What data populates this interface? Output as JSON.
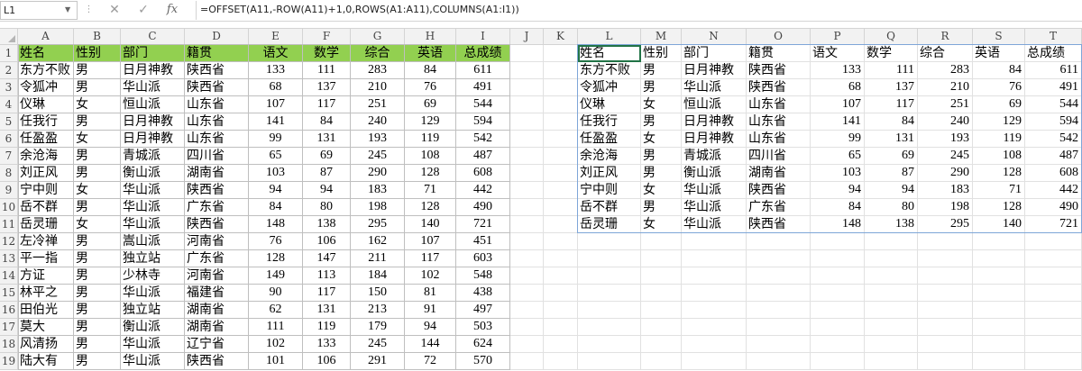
{
  "formula_bar": {
    "name_box": "L1",
    "dots": "⋮",
    "cancel_icon": "✕",
    "enter_icon": "✓",
    "fx_icon": "fx",
    "formula": "=OFFSET(A11,-ROW(A11)+1,0,ROWS(A1:A11),COLUMNS(A1:I1))"
  },
  "columns": [
    "A",
    "B",
    "C",
    "D",
    "E",
    "F",
    "G",
    "H",
    "I",
    "J",
    "K",
    "L",
    "M",
    "N",
    "O",
    "P",
    "Q",
    "R",
    "S",
    "T"
  ],
  "rows": [
    "1",
    "2",
    "3",
    "4",
    "5",
    "6",
    "7",
    "8",
    "9",
    "10",
    "11",
    "12",
    "13",
    "14",
    "15",
    "16",
    "17",
    "18",
    "19"
  ],
  "headers": [
    "姓名",
    "性别",
    "部门",
    "籍贯",
    "语文",
    "数学",
    "综合",
    "英语",
    "总成绩"
  ],
  "records": [
    [
      "东方不败",
      "男",
      "日月神教",
      "陕西省",
      "133",
      "111",
      "283",
      "84",
      "611"
    ],
    [
      "令狐冲",
      "男",
      "华山派",
      "陕西省",
      "68",
      "137",
      "210",
      "76",
      "491"
    ],
    [
      "仪琳",
      "女",
      "恒山派",
      "山东省",
      "107",
      "117",
      "251",
      "69",
      "544"
    ],
    [
      "任我行",
      "男",
      "日月神教",
      "山东省",
      "141",
      "84",
      "240",
      "129",
      "594"
    ],
    [
      "任盈盈",
      "女",
      "日月神教",
      "山东省",
      "99",
      "131",
      "193",
      "119",
      "542"
    ],
    [
      "余沧海",
      "男",
      "青城派",
      "四川省",
      "65",
      "69",
      "245",
      "108",
      "487"
    ],
    [
      "刘正风",
      "男",
      "衡山派",
      "湖南省",
      "103",
      "87",
      "290",
      "128",
      "608"
    ],
    [
      "宁中则",
      "女",
      "华山派",
      "陕西省",
      "94",
      "94",
      "183",
      "71",
      "442"
    ],
    [
      "岳不群",
      "男",
      "华山派",
      "广东省",
      "84",
      "80",
      "198",
      "128",
      "490"
    ],
    [
      "岳灵珊",
      "女",
      "华山派",
      "陕西省",
      "148",
      "138",
      "295",
      "140",
      "721"
    ],
    [
      "左冷禅",
      "男",
      "嵩山派",
      "河南省",
      "76",
      "106",
      "162",
      "107",
      "451"
    ],
    [
      "平一指",
      "男",
      "独立站",
      "广东省",
      "128",
      "147",
      "211",
      "117",
      "603"
    ],
    [
      "方证",
      "男",
      "少林寺",
      "河南省",
      "149",
      "113",
      "184",
      "102",
      "548"
    ],
    [
      "林平之",
      "男",
      "华山派",
      "福建省",
      "90",
      "117",
      "150",
      "81",
      "438"
    ],
    [
      "田伯光",
      "男",
      "独立站",
      "湖南省",
      "62",
      "131",
      "213",
      "91",
      "497"
    ],
    [
      "莫大",
      "男",
      "衡山派",
      "湖南省",
      "111",
      "119",
      "179",
      "94",
      "503"
    ],
    [
      "风清扬",
      "男",
      "华山派",
      "辽宁省",
      "102",
      "133",
      "245",
      "144",
      "624"
    ],
    [
      "陆大有",
      "男",
      "华山派",
      "陕西省",
      "101",
      "106",
      "291",
      "72",
      "570"
    ]
  ],
  "colors": {
    "header_fill": "#92d050",
    "selection": "#217346",
    "range_border": "#7ea6d8"
  }
}
